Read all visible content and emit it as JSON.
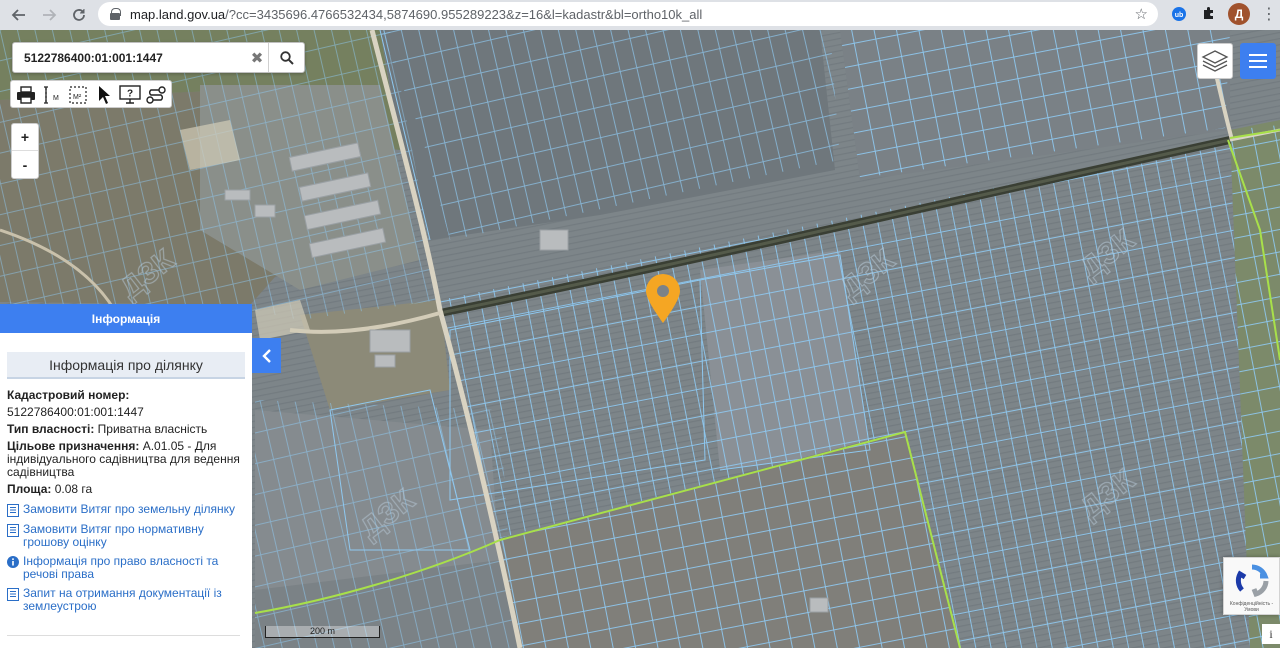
{
  "browser": {
    "url_host": "map.land.gov.ua",
    "url_rest": "/?cc=3435696.4766532434,5874690.955289223&z=16&l=kadastr&bl=ortho10k_all",
    "avatar_letter": "Д"
  },
  "search": {
    "value": "5122786400:01:001:1447",
    "clear_label": "✖"
  },
  "zoom": {
    "in_label": "+",
    "out_label": "-"
  },
  "tools": [
    {
      "name": "print-icon"
    },
    {
      "name": "measure-length-icon"
    },
    {
      "name": "measure-area-icon"
    },
    {
      "name": "select-pointer-icon"
    },
    {
      "name": "help-screen-icon"
    },
    {
      "name": "route-icon"
    }
  ],
  "panel": {
    "header": "Інформація",
    "title": "Інформація про ділянку",
    "cadastral_label": "Кадастровий номер:",
    "cadastral_value": "5122786400:01:001:1447",
    "ownership_label": "Тип власності:",
    "ownership_value": "Приватна власність",
    "purpose_label": "Цільове призначення:",
    "purpose_value": "А.01.05 - Для індивідуального садівництва для ведення садівництва",
    "area_label": "Площа:",
    "area_value": "0.08 га",
    "links": [
      {
        "icon": "document-icon",
        "text": "Замовити Витяг про земельну ділянку"
      },
      {
        "icon": "document-icon",
        "text": "Замовити Витяг про нормативну грошову оцінку"
      },
      {
        "icon": "info-circle-icon",
        "text": "Інформація про право власності та речові права"
      },
      {
        "icon": "document-icon",
        "text": "Запит на отримання документації із землеустрою"
      }
    ]
  },
  "map": {
    "scale_label": "200 m",
    "watermarks": [
      "ДЗК",
      "ДЗК",
      "ДЗК",
      "ДЗК",
      "ДЗК"
    ],
    "recaptcha_text": "Конфіденційність - Умови",
    "marker_color": "#f5a623",
    "parcel_color": "#8ec8f0",
    "boundary_color": "#a8e04a"
  }
}
